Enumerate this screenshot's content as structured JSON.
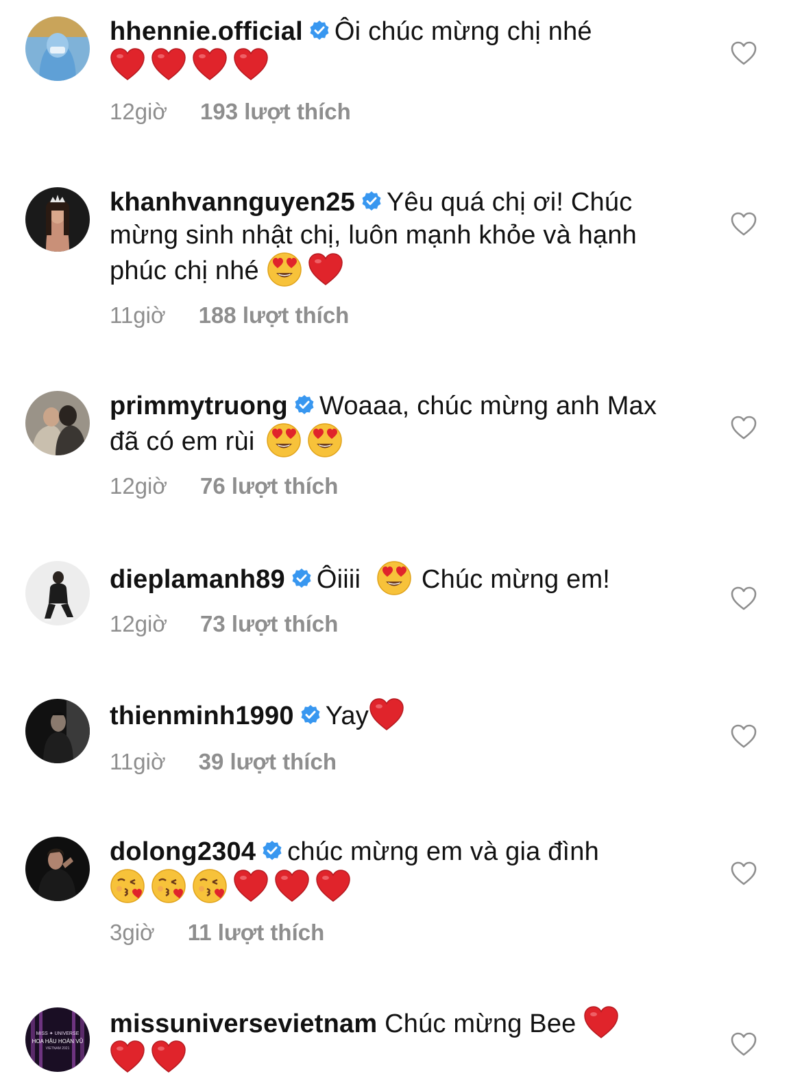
{
  "comments": [
    {
      "username": "hhennie.official",
      "verified": true,
      "text": "Ôi chúc mừng chị nhé",
      "emojis": [
        "red-heart",
        "red-heart",
        "red-heart",
        "red-heart"
      ],
      "time": "12giờ",
      "likes": "193 lượt thích"
    },
    {
      "username": "khanhvannguyen25",
      "verified": true,
      "text": "Yêu quá chị ơi! Chúc mừng sinh nhật chị, luôn mạnh khỏe và hạnh phúc chị nhé",
      "emojis": [
        "heart-eyes-face",
        "red-heart"
      ],
      "time": "11giờ",
      "likes": "188 lượt thích"
    },
    {
      "username": "primmytruong",
      "verified": true,
      "text": "Woaaa, chúc mừng anh Max đã có em rùi",
      "emojis": [
        "heart-eyes-face",
        "heart-eyes-face"
      ],
      "time": "12giờ",
      "likes": "76 lượt thích"
    },
    {
      "username": "dieplamanh89",
      "verified": true,
      "text_before": "Ôiiii",
      "text_after": "Chúc mừng em!",
      "emojis": [
        "heart-eyes-face"
      ],
      "time": "12giờ",
      "likes": "73 lượt thích"
    },
    {
      "username": "thienminh1990",
      "verified": true,
      "text": "Yay",
      "emojis": [
        "red-heart"
      ],
      "time": "11giờ",
      "likes": "39 lượt thích"
    },
    {
      "username": "dolong2304",
      "verified": true,
      "text": "chúc mừng em và gia đình",
      "emojis": [
        "kissing-face",
        "kissing-face",
        "kissing-face",
        "red-heart",
        "red-heart",
        "red-heart"
      ],
      "time": "3giờ",
      "likes": "11 lượt thích"
    },
    {
      "username": "missuniversevietnam",
      "verified": false,
      "text": "Chúc mừng Bee",
      "emojis": [
        "red-heart",
        "red-heart",
        "red-heart"
      ],
      "avatar_text": {
        "line1": "MISS ✦ UNIVERSE",
        "line2": "HOA HẬU HOÀN VŨ",
        "line3": "VIETNAM 2021"
      }
    }
  ],
  "icons": {
    "verified": "verified-badge-icon",
    "like": "heart-outline-icon"
  },
  "colors": {
    "verified_blue": "#3897f0",
    "meta_gray": "#8e8e8e",
    "heart_red": "#e0242b"
  }
}
